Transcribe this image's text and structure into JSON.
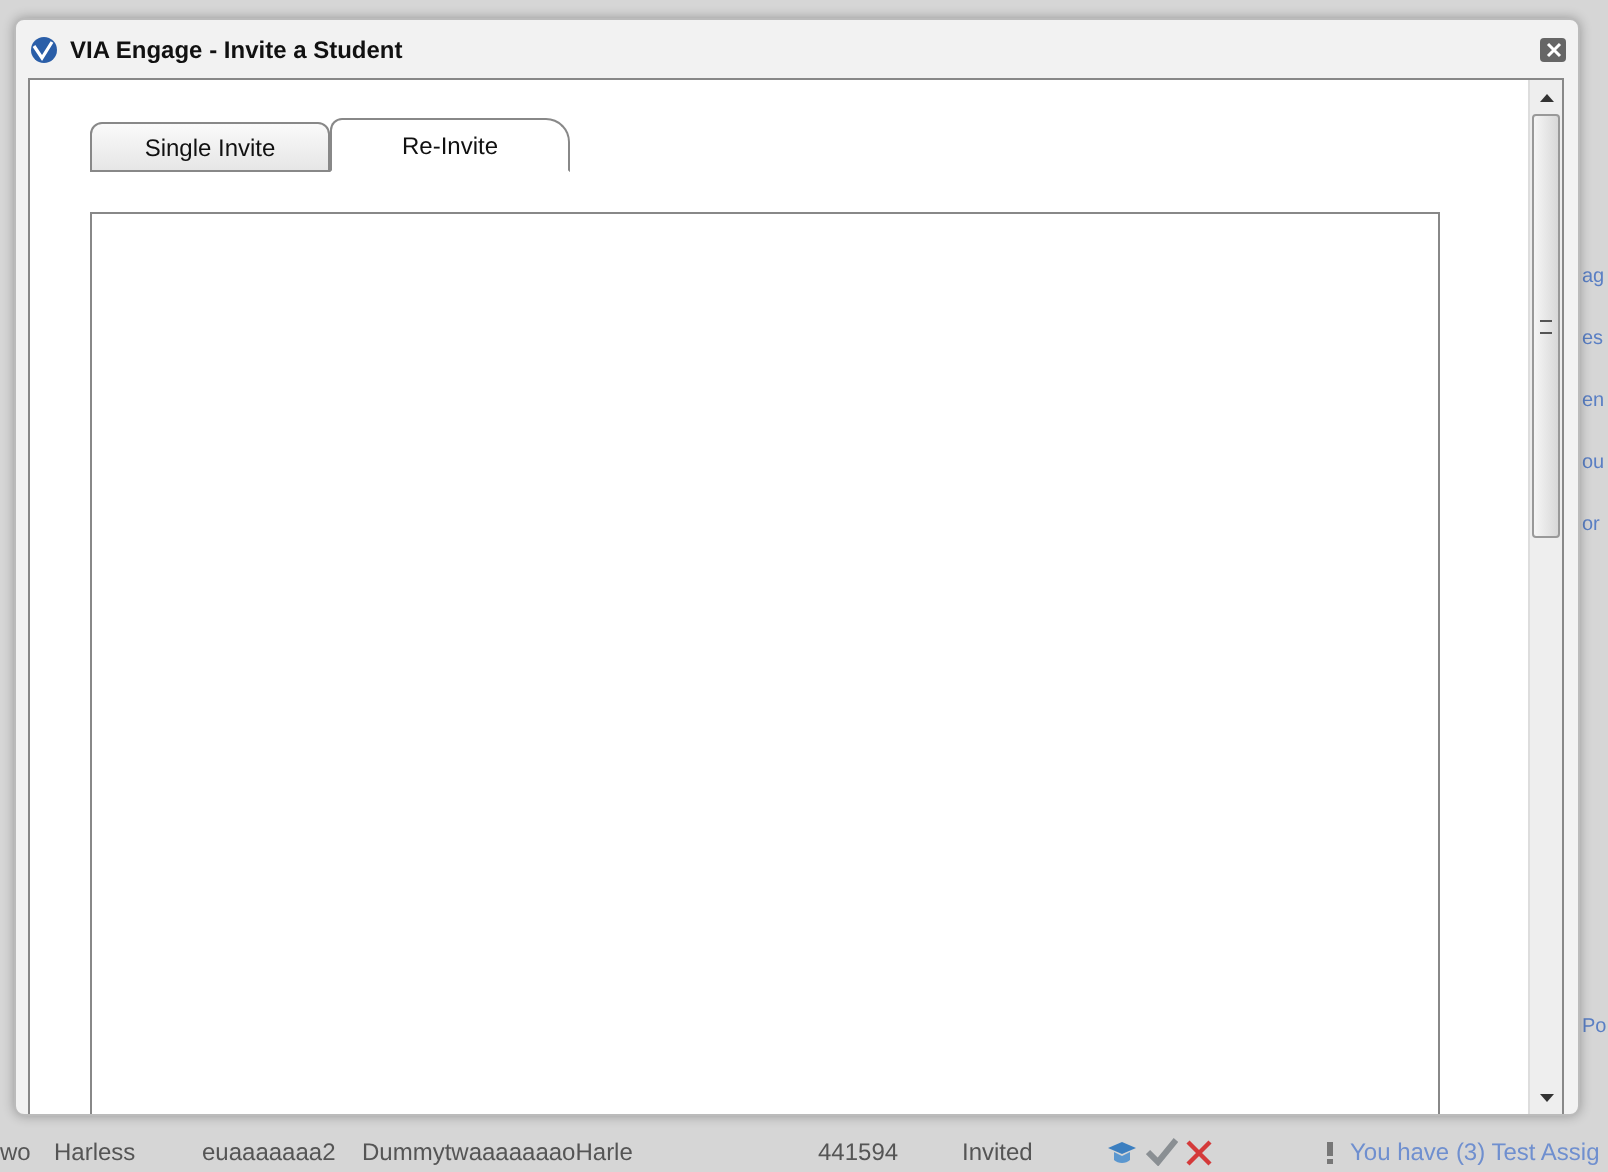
{
  "background": {
    "right_fragments": [
      "ag",
      "es",
      "en",
      "ou",
      "or",
      "Po"
    ],
    "row": {
      "cells": [
        "wo",
        "Harless",
        "euaaaaaaa2",
        "DummytwaaaaaaaoHarle",
        "441594",
        "Invited"
      ]
    },
    "notice": "You have (3) Test Assig"
  },
  "window": {
    "title": "VIA Engage - Invite a Student"
  },
  "tabs": [
    {
      "label": "Single Invite",
      "selected": false
    },
    {
      "label": "Re-Invite",
      "selected": true
    }
  ]
}
